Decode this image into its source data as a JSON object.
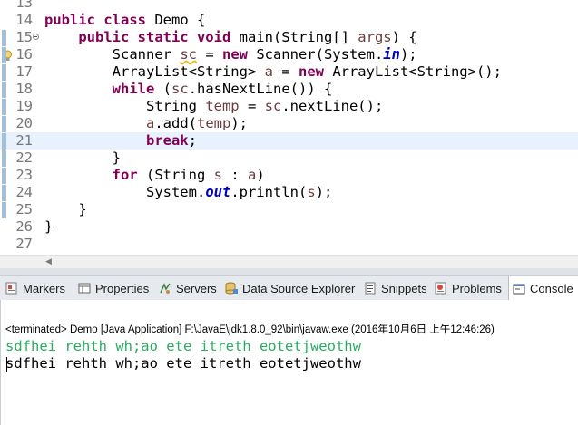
{
  "editor": {
    "lines": [
      {
        "num": "13",
        "tokens": []
      },
      {
        "num": "14",
        "tokens": [
          {
            "t": "public class ",
            "c": "k"
          },
          {
            "t": "Demo {"
          }
        ]
      },
      {
        "num": "15",
        "fold": true,
        "tokens": [
          {
            "t": "    "
          },
          {
            "t": "public static void ",
            "c": "k"
          },
          {
            "t": "main(String[] "
          },
          {
            "t": "args",
            "c": "v"
          },
          {
            "t": ") {"
          }
        ]
      },
      {
        "num": "16",
        "warning": true,
        "tokens": [
          {
            "t": "        Scanner "
          },
          {
            "t": "sc",
            "c": "v u"
          },
          {
            "t": " = "
          },
          {
            "t": "new ",
            "c": "k"
          },
          {
            "t": "Scanner(System."
          },
          {
            "t": "in",
            "c": "f"
          },
          {
            "t": ");"
          }
        ]
      },
      {
        "num": "17",
        "tokens": [
          {
            "t": "        ArrayList<String> "
          },
          {
            "t": "a",
            "c": "v"
          },
          {
            "t": " = "
          },
          {
            "t": "new ",
            "c": "k"
          },
          {
            "t": "ArrayList<String>();"
          }
        ]
      },
      {
        "num": "18",
        "tokens": [
          {
            "t": "        "
          },
          {
            "t": "while ",
            "c": "k"
          },
          {
            "t": "("
          },
          {
            "t": "sc",
            "c": "v"
          },
          {
            "t": ".hasNextLine()) {"
          }
        ]
      },
      {
        "num": "19",
        "tokens": [
          {
            "t": "            String "
          },
          {
            "t": "temp",
            "c": "v"
          },
          {
            "t": " = "
          },
          {
            "t": "sc",
            "c": "v"
          },
          {
            "t": ".nextLine();"
          }
        ]
      },
      {
        "num": "20",
        "tokens": [
          {
            "t": "            "
          },
          {
            "t": "a",
            "c": "v"
          },
          {
            "t": ".add("
          },
          {
            "t": "temp",
            "c": "v"
          },
          {
            "t": ");"
          }
        ]
      },
      {
        "num": "21",
        "current": true,
        "tokens": [
          {
            "t": "            "
          },
          {
            "t": "break",
            "c": "k"
          },
          {
            "t": ";"
          }
        ]
      },
      {
        "num": "22",
        "tokens": [
          {
            "t": "        }"
          }
        ]
      },
      {
        "num": "23",
        "tokens": [
          {
            "t": "        "
          },
          {
            "t": "for ",
            "c": "k"
          },
          {
            "t": "(String "
          },
          {
            "t": "s",
            "c": "v"
          },
          {
            "t": " : "
          },
          {
            "t": "a",
            "c": "v"
          },
          {
            "t": ")"
          }
        ]
      },
      {
        "num": "24",
        "tokens": [
          {
            "t": "            System."
          },
          {
            "t": "out",
            "c": "f"
          },
          {
            "t": ".println("
          },
          {
            "t": "s",
            "c": "v"
          },
          {
            "t": ");"
          }
        ]
      },
      {
        "num": "25",
        "tokens": [
          {
            "t": "    }"
          }
        ]
      },
      {
        "num": "26",
        "tokens": [
          {
            "t": "}"
          }
        ]
      },
      {
        "num": "27",
        "tokens": []
      }
    ]
  },
  "tabs": [
    {
      "label": "Markers",
      "icon": "markers-icon"
    },
    {
      "label": "Properties",
      "icon": "properties-icon"
    },
    {
      "label": "Servers",
      "icon": "servers-icon"
    },
    {
      "label": "Data Source Explorer",
      "icon": "data-source-icon"
    },
    {
      "label": "Snippets",
      "icon": "snippets-icon"
    },
    {
      "label": "Problems",
      "icon": "problems-icon"
    },
    {
      "label": "Console",
      "icon": "console-icon",
      "active": true
    }
  ],
  "console": {
    "status": "<terminated> Demo [Java Application] F:\\JavaE\\jdk1.8.0_92\\bin\\javaw.exe (2016年10月6日 上午12:46:26)",
    "output_lines": [
      "sdfhei rehth wh;ao ete itreth eotetjweothw",
      "sdfhei rehth wh;ao ete itreth eotetjweothw"
    ]
  },
  "colors": {
    "keyword": "#7f0055",
    "variable": "#6a3e3e",
    "static_field": "#0000c0",
    "console_input": "#27ae60",
    "current_line": "#e8f2fe"
  }
}
